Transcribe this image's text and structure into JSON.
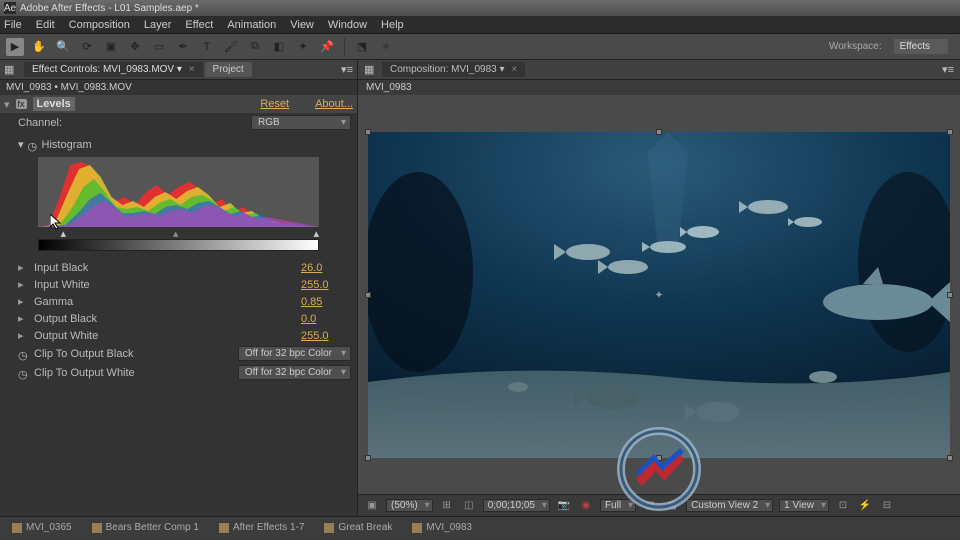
{
  "titlebar": {
    "text": "Adobe After Effects - L01 Samples.aep *"
  },
  "menu": [
    "File",
    "Edit",
    "Composition",
    "Layer",
    "Effect",
    "Animation",
    "View",
    "Window",
    "Help"
  ],
  "workspace": {
    "label": "Workspace:",
    "value": "Effects"
  },
  "left": {
    "tab_effect": "Effect Controls: MVI_0983.MOV",
    "tab_project": "Project",
    "breadcrumb": "MVI_0983 • MVI_0983.MOV",
    "effect_name": "Levels",
    "reset": "Reset",
    "about": "About...",
    "channel_label": "Channel:",
    "channel_value": "RGB",
    "histogram_label": "Histogram",
    "props": [
      {
        "label": "Input Black",
        "value": "26.0"
      },
      {
        "label": "Input White",
        "value": "255.0"
      },
      {
        "label": "Gamma",
        "value": "0.85"
      },
      {
        "label": "Output Black",
        "value": "0.0"
      },
      {
        "label": "Output White",
        "value": "255.0"
      }
    ],
    "clip_black_label": "Clip To Output Black",
    "clip_black_value": "Off for 32 bpc Color",
    "clip_white_label": "Clip To Output White",
    "clip_white_value": "Off for 32 bpc Color"
  },
  "right": {
    "tab": "Composition: MVI_0983",
    "subhead": "MVI_0983",
    "footer": {
      "zoom": "(50%)",
      "timecode": "0;00;10;05",
      "res": "Full",
      "view2": "Custom View 2",
      "view1": "1 View"
    }
  },
  "bottom": [
    "MVI_0365",
    "Bears Better Comp 1",
    "After Effects 1-7",
    "Great Break",
    "MVI_0983"
  ]
}
